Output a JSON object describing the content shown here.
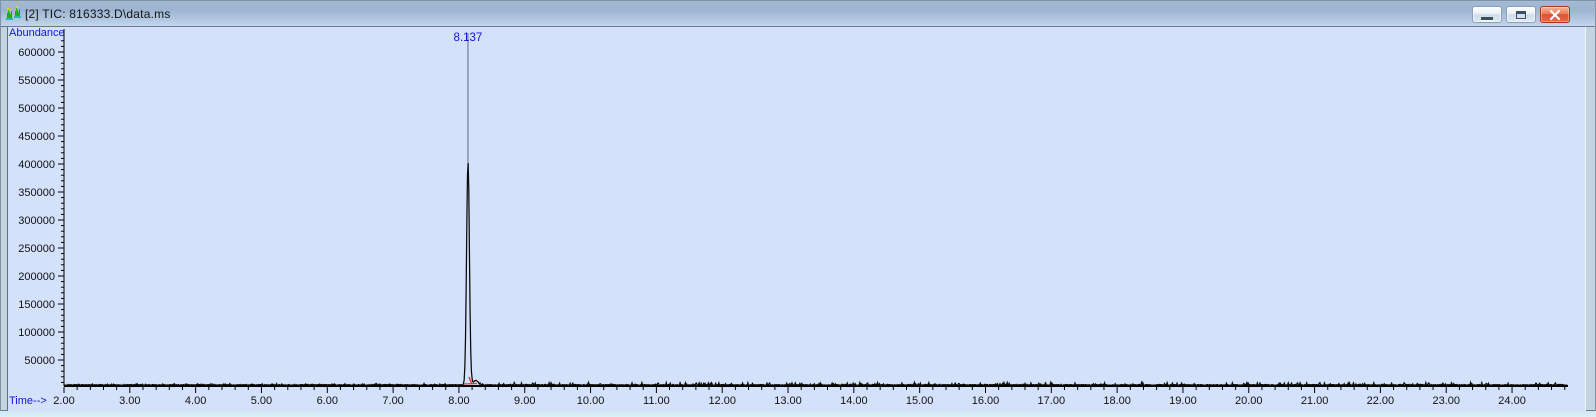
{
  "window": {
    "title": "[2] TIC: 816333.D\\data.ms",
    "icon": "chromatogram-icon",
    "controls": {
      "minimize": "Minimize",
      "restore": "Restore",
      "close": "Close"
    }
  },
  "chart_data": {
    "type": "line",
    "title": "TIC: 816333.D\\data.ms",
    "ylabel": "Abundance",
    "xlabel": "Time-->",
    "xlim": [
      2.0,
      24.85
    ],
    "ylim": [
      0,
      645000
    ],
    "x_major_tick_interval": 1.0,
    "x_minor_tick_interval": 0.2,
    "y_major_tick_interval": 50000,
    "y_minor_tick_interval": 10000,
    "x_tick_labels": [
      "2.00",
      "3.00",
      "4.00",
      "5.00",
      "6.00",
      "7.00",
      "8.00",
      "9.00",
      "10.00",
      "11.00",
      "12.00",
      "13.00",
      "14.00",
      "15.00",
      "16.00",
      "17.00",
      "18.00",
      "19.00",
      "20.00",
      "21.00",
      "22.00",
      "23.00",
      "24.00"
    ],
    "y_tick_labels": [
      "600000",
      "550000",
      "500000",
      "450000",
      "400000",
      "350000",
      "300000",
      "250000",
      "200000",
      "150000",
      "100000",
      "50000"
    ],
    "grid": false,
    "legend": null,
    "baseline_level": 5500,
    "noise_amplitude": 3500,
    "peaks": [
      {
        "retention_time": 8.137,
        "label": "8.137",
        "apex_abundance": 402000,
        "sigma_min": 0.021
      }
    ],
    "colors": {
      "trace": "#0a0a0a",
      "axis": "#000000",
      "tick_text": "#111111",
      "annotation_text": "#1414dd",
      "peak_connector": "#6f7f93",
      "integration_marks": "#e03434",
      "plot_background": "#d3e2fa"
    }
  }
}
